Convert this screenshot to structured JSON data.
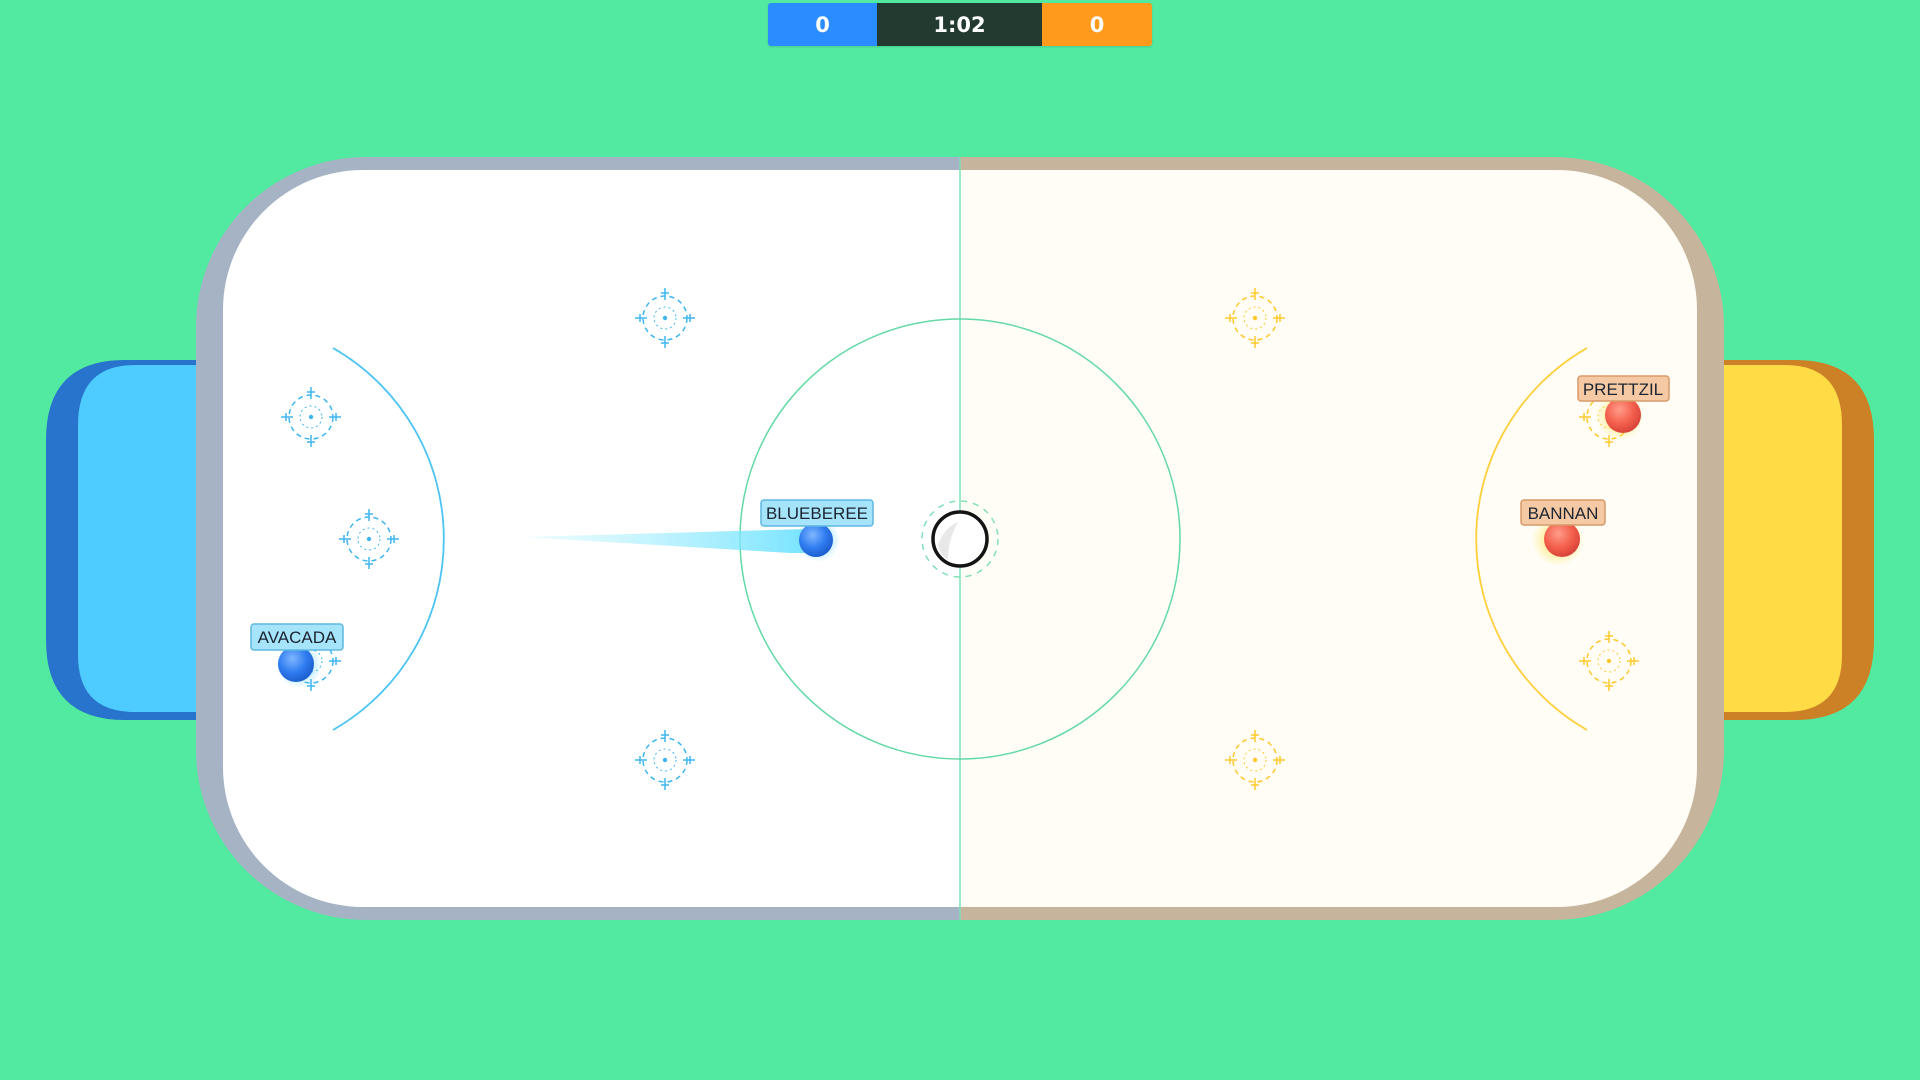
{
  "scoreboard": {
    "blue_score": "0",
    "timer": "1:02",
    "orange_score": "0"
  },
  "teams": {
    "blue": {
      "color": "#2b8cff",
      "goal_color": "#4ecbff",
      "goal_shadow": "#2873cc",
      "marker_color": "#3fb6f0"
    },
    "orange": {
      "color": "#ff9a1d",
      "goal_color": "#ffdb45",
      "goal_shadow": "#cc8126",
      "marker_color": "#ffc82e"
    }
  },
  "players": [
    {
      "name": "BLUEBEREE",
      "team": "blue"
    },
    {
      "name": "AVACADA",
      "team": "blue"
    },
    {
      "name": "PRETTZIL",
      "team": "orange"
    },
    {
      "name": "BANNAN",
      "team": "orange"
    }
  ],
  "background_color": "#52e9a1"
}
